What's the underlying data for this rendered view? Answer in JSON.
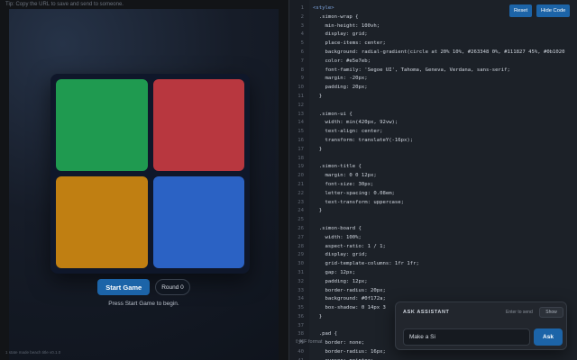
{
  "preview": {
    "tip": "Tip: Copy the URL to save and send to someone.",
    "start_label": "Start Game",
    "round_label": "Round 0",
    "status": "Press Start Game to begin.",
    "footnote": "1 state made beach title v0.1.0",
    "pads": [
      {
        "name": "green",
        "color": "#1f9a50"
      },
      {
        "name": "red",
        "color": "#b8373f"
      },
      {
        "name": "yellow",
        "color": "#c07f12"
      },
      {
        "name": "blue",
        "color": "#2b62c4"
      }
    ]
  },
  "toolbar": {
    "reset_label": "Reset",
    "hide_code_label": "Hide Code"
  },
  "editor": {
    "format_label": "⇧⌘F format",
    "lines": [
      {
        "n": "1",
        "text": "<style>"
      },
      {
        "n": "2",
        "text": "  .simon-wrap {"
      },
      {
        "n": "3",
        "text": "    min-height: 100vh;"
      },
      {
        "n": "4",
        "text": "    display: grid;"
      },
      {
        "n": "5",
        "text": "    place-items: center;"
      },
      {
        "n": "6",
        "text": "    background: radial-gradient(circle at 20% 10%, #263348 0%, #111827 45%, #0b1020"
      },
      {
        "n": "7",
        "text": "    color: #e5e7eb;"
      },
      {
        "n": "8",
        "text": "    font-family: 'Segoe UI', Tahoma, Geneva, Verdana, sans-serif;"
      },
      {
        "n": "9",
        "text": "    margin: -20px;"
      },
      {
        "n": "10",
        "text": "    padding: 20px;"
      },
      {
        "n": "11",
        "text": "  }"
      },
      {
        "n": "12",
        "text": ""
      },
      {
        "n": "13",
        "text": "  .simon-ui {"
      },
      {
        "n": "14",
        "text": "    width: min(420px, 92vw);"
      },
      {
        "n": "15",
        "text": "    text-align: center;"
      },
      {
        "n": "16",
        "text": "    transform: translateY(-16px);"
      },
      {
        "n": "17",
        "text": "  }"
      },
      {
        "n": "18",
        "text": ""
      },
      {
        "n": "19",
        "text": "  .simon-title {"
      },
      {
        "n": "20",
        "text": "    margin: 0 0 12px;"
      },
      {
        "n": "21",
        "text": "    font-size: 30px;"
      },
      {
        "n": "22",
        "text": "    letter-spacing: 0.08em;"
      },
      {
        "n": "23",
        "text": "    text-transform: uppercase;"
      },
      {
        "n": "24",
        "text": "  }"
      },
      {
        "n": "25",
        "text": ""
      },
      {
        "n": "26",
        "text": "  .simon-board {"
      },
      {
        "n": "27",
        "text": "    width: 100%;"
      },
      {
        "n": "28",
        "text": "    aspect-ratio: 1 / 1;"
      },
      {
        "n": "29",
        "text": "    display: grid;"
      },
      {
        "n": "30",
        "text": "    grid-template-columns: 1fr 1fr;"
      },
      {
        "n": "31",
        "text": "    gap: 12px;"
      },
      {
        "n": "32",
        "text": "    padding: 12px;"
      },
      {
        "n": "33",
        "text": "    border-radius: 20px;"
      },
      {
        "n": "34",
        "text": "    background: #0f172a;"
      },
      {
        "n": "35",
        "text": "    box-shadow: 0 14px 3"
      },
      {
        "n": "36",
        "text": "  }"
      },
      {
        "n": "37",
        "text": ""
      },
      {
        "n": "38",
        "text": "  .pad {"
      },
      {
        "n": "39",
        "text": "    border: none;"
      },
      {
        "n": "40",
        "text": "    border-radius: 16px;"
      },
      {
        "n": "41",
        "text": "    cursor: pointer;"
      }
    ]
  },
  "assistant": {
    "title": "ASK ASSISTANT",
    "hint": "Enter to send",
    "show_label": "Show",
    "input_value": "Make a Si",
    "ask_label": "Ask"
  }
}
